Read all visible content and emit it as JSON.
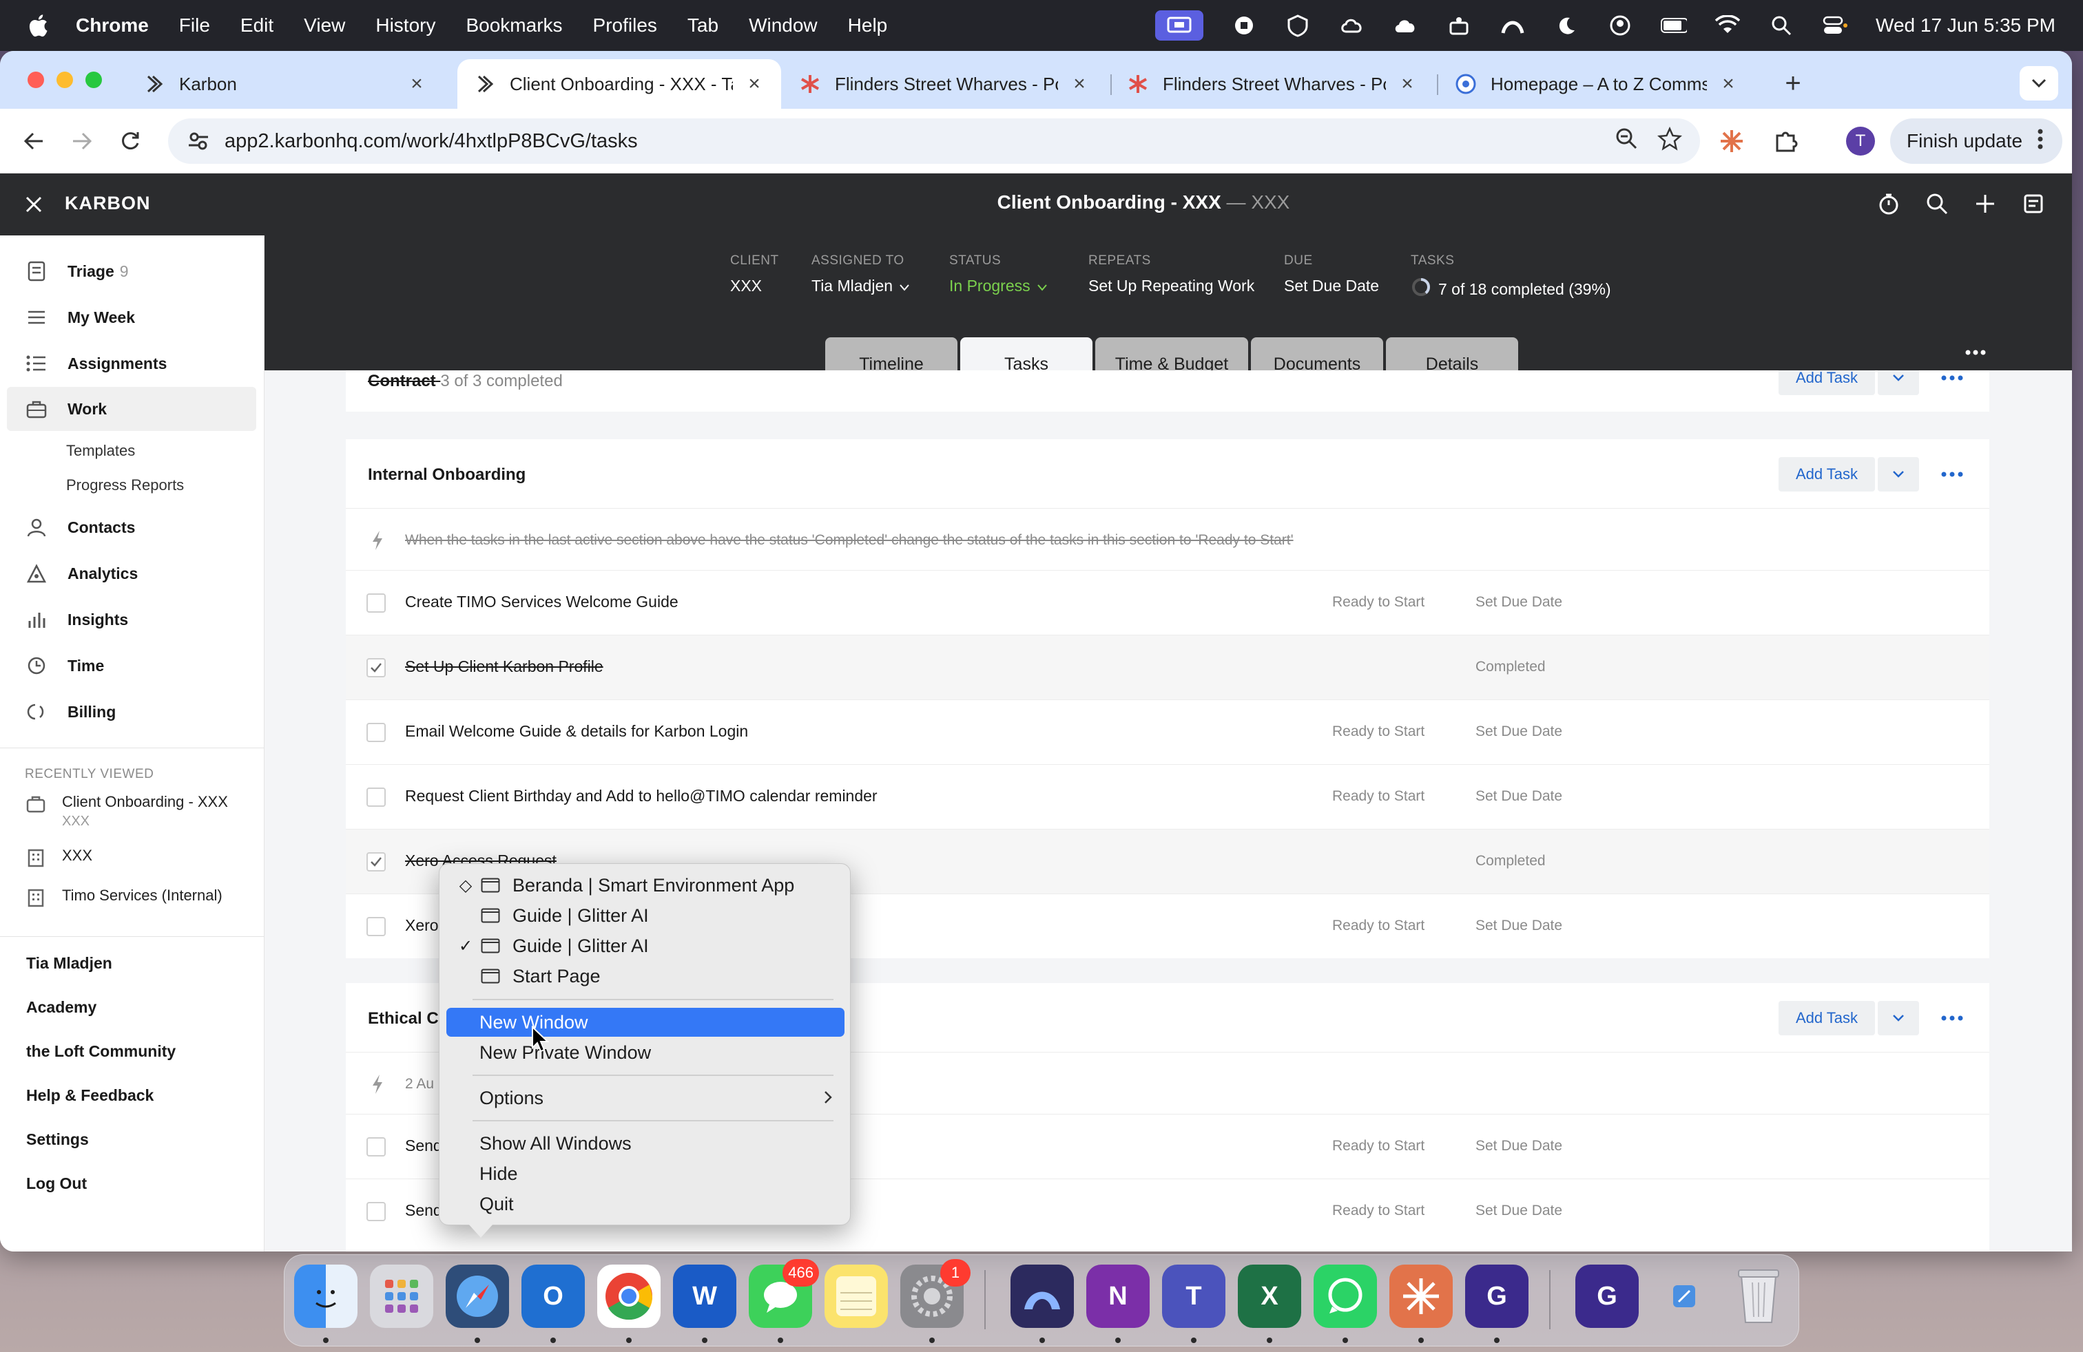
{
  "menubar": {
    "app_name": "Chrome",
    "items": [
      "File",
      "Edit",
      "View",
      "History",
      "Bookmarks",
      "Profiles",
      "Tab",
      "Window",
      "Help"
    ],
    "clock": "Wed 17 Jun  5:35 PM"
  },
  "browser": {
    "tabs": [
      {
        "title": "Karbon",
        "icon": "karbon-icon"
      },
      {
        "title": "Client Onboarding - XXX - Ta",
        "icon": "karbon-icon",
        "active": true
      },
      {
        "title": "Flinders Street Wharves - Pov",
        "icon": "asterisk-icon"
      },
      {
        "title": "Flinders Street Wharves - Pov",
        "icon": "asterisk-icon"
      },
      {
        "title": "Homepage – A to Z Comms &",
        "icon": "globe-icon"
      }
    ],
    "url": "app2.karbonhq.com/work/4hxtlpP8BCvG/tasks",
    "profile_initial": "T",
    "finish_update": "Finish update"
  },
  "karbon": {
    "brand": "KARBON",
    "work_title": "Client Onboarding - XXX",
    "work_title_suffix": "— XXX",
    "sidebar": {
      "items": [
        {
          "label": "Triage",
          "count": "9",
          "icon": "triage-icon"
        },
        {
          "label": "My Week",
          "icon": "list-icon"
        },
        {
          "label": "Assignments",
          "icon": "assignments-icon"
        },
        {
          "label": "Work",
          "icon": "briefcase-icon",
          "active": true
        },
        {
          "label": "Contacts",
          "icon": "contacts-icon"
        },
        {
          "label": "Analytics",
          "icon": "analytics-icon"
        },
        {
          "label": "Insights",
          "icon": "bar-chart-icon"
        },
        {
          "label": "Time",
          "icon": "clock-icon"
        },
        {
          "label": "Billing",
          "icon": "billing-icon"
        }
      ],
      "work_sub": [
        "Templates",
        "Progress Reports"
      ],
      "recently_viewed_label": "RECENTLY VIEWED",
      "recent": [
        {
          "title": "Client Onboarding - XXX",
          "sub": "XXX"
        },
        {
          "title": "XXX",
          "sub": ""
        },
        {
          "title": "Timo Services (Internal)",
          "sub": ""
        }
      ],
      "footer": [
        "Tia Mladjen",
        "Academy",
        "the Loft Community",
        "Help & Feedback",
        "Settings",
        "Log Out"
      ]
    },
    "meta": {
      "client_label": "CLIENT",
      "client": "XXX",
      "assigned_label": "ASSIGNED TO",
      "assigned": "Tia Mladjen",
      "status_label": "STATUS",
      "status": "In Progress",
      "repeats_label": "REPEATS",
      "repeats": "Set Up Repeating Work",
      "due_label": "DUE",
      "due": "Set Due Date",
      "tasks_label": "TASKS",
      "tasks": "7 of 18 completed (39%)",
      "tasks_progress": 0.39
    },
    "tabs": [
      "Timeline",
      "Tasks",
      "Time & Budget",
      "Documents",
      "Details"
    ],
    "active_tab": "Tasks",
    "sections": {
      "contract": {
        "title": "Contract",
        "count": "3 of 3 completed",
        "add_task": "Add Task"
      },
      "internal": {
        "title": "Internal Onboarding",
        "add_task": "Add Task",
        "automation": "When the tasks in the last active section above have the status 'Completed' change the status of the tasks in this section to 'Ready to Start'",
        "tasks": [
          {
            "name": "Create TIMO Services Welcome Guide",
            "status": "Ready to Start",
            "due": "Set Due Date",
            "done": false
          },
          {
            "name": "Set Up Client Karbon Profile",
            "status": "",
            "due": "Completed",
            "done": true
          },
          {
            "name": "Email Welcome Guide & details for Karbon Login",
            "status": "Ready to Start",
            "due": "Set Due Date",
            "done": false
          },
          {
            "name": "Request Client Birthday and Add to hello@TIMO calendar reminder",
            "status": "Ready to Start",
            "due": "Set Due Date",
            "done": false
          },
          {
            "name": "Xero Access Request",
            "status": "",
            "due": "Completed",
            "done": true
          },
          {
            "name": "Xero",
            "status": "Ready to Start",
            "due": "Set Due Date",
            "done": false
          }
        ]
      },
      "ethical": {
        "title": "Ethical Cl",
        "add_task": "Add Task",
        "automation": "2 Au",
        "tasks": [
          {
            "name": "Send",
            "status": "Ready to Start",
            "due": "Set Due Date",
            "done": false
          },
          {
            "name": "Send",
            "status": "Ready to Start",
            "due": "Set Due Date",
            "done": false
          }
        ]
      }
    }
  },
  "context_menu": {
    "windows": [
      {
        "label": "Beranda | Smart Environment App",
        "mark": "◇"
      },
      {
        "label": "Guide | Glitter AI",
        "mark": ""
      },
      {
        "label": "Guide | Glitter AI",
        "mark": "✓"
      },
      {
        "label": "Start Page",
        "mark": ""
      }
    ],
    "new_window": "New Window",
    "new_private_window": "New Private Window",
    "options": "Options",
    "show_all": "Show All Windows",
    "hide": "Hide",
    "quit": "Quit"
  },
  "dock": {
    "apps": [
      {
        "name": "Finder",
        "icon": "finder-icon"
      },
      {
        "name": "Launchpad",
        "icon": "launchpad-icon"
      },
      {
        "name": "Safari",
        "icon": "safari-icon"
      },
      {
        "name": "Outlook",
        "icon": "outlook-icon",
        "letter": "O"
      },
      {
        "name": "Chrome",
        "icon": "chrome-icon"
      },
      {
        "name": "Word",
        "icon": "word-icon",
        "letter": "W"
      },
      {
        "name": "Messages",
        "icon": "messages-icon",
        "badge": "466"
      },
      {
        "name": "Notes",
        "icon": "notes-icon"
      },
      {
        "name": "System Settings",
        "icon": "settings-icon",
        "badge": "1"
      },
      {
        "name": "Proton VPN",
        "icon": "vpn-icon"
      },
      {
        "name": "OneNote",
        "icon": "onenote-icon",
        "letter": "N"
      },
      {
        "name": "Teams",
        "icon": "teams-icon",
        "letter": "T"
      },
      {
        "name": "Excel",
        "icon": "excel-icon",
        "letter": "X"
      },
      {
        "name": "WhatsApp",
        "icon": "whatsapp-icon"
      },
      {
        "name": "Claude",
        "icon": "claude-icon"
      },
      {
        "name": "Glitter",
        "icon": "glitter-icon",
        "letter": "G"
      },
      {
        "name": "Glitter Recent",
        "icon": "glitter-icon",
        "letter": "G"
      },
      {
        "name": "Trash",
        "icon": "trash-icon"
      }
    ]
  }
}
